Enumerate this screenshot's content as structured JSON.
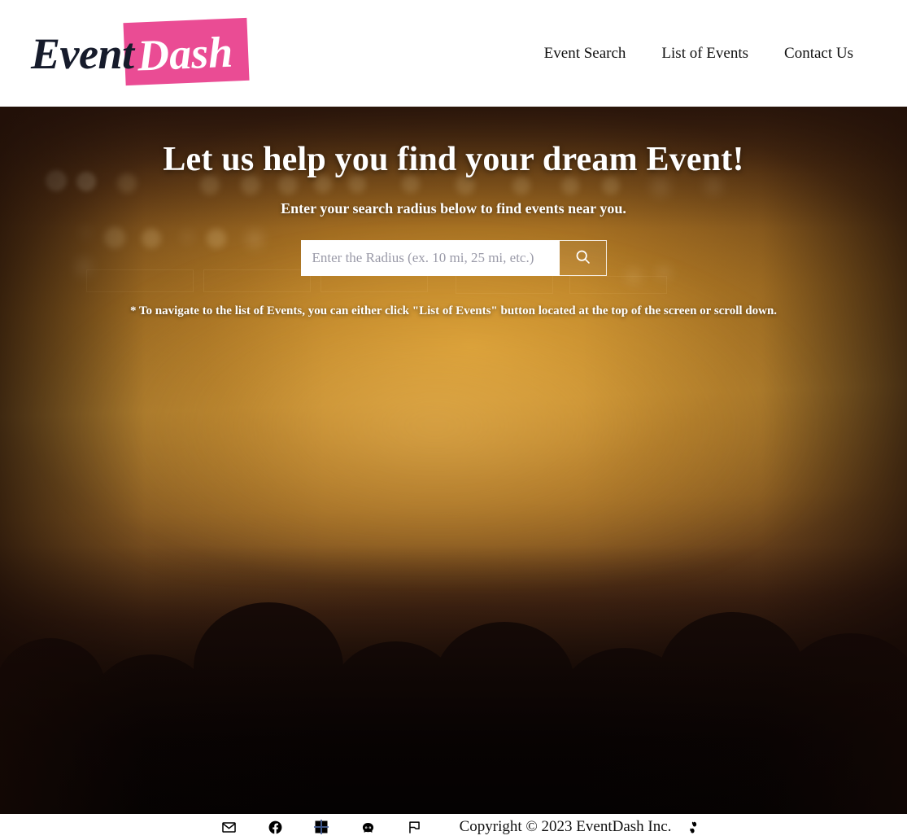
{
  "header": {
    "logo": {
      "part1": "Event",
      "part2": "Dash",
      "accent_color": "#ea4c94",
      "text_color": "#161b2b"
    },
    "nav": [
      {
        "label": "Event Search",
        "name": "nav-event-search"
      },
      {
        "label": "List of Events",
        "name": "nav-list-of-events"
      },
      {
        "label": "Contact Us",
        "name": "nav-contact-us"
      }
    ]
  },
  "hero": {
    "title": "Let us help you find your dream Event!",
    "subtitle": "Enter your search radius below to find events near you.",
    "search": {
      "value": "",
      "placeholder": "Enter the Radius (ex. 10 mi, 25 mi, etc.)",
      "button_icon": "search-icon"
    },
    "note": "* To navigate to the list of Events, you can either click \"List of Events\" button located at the top of the screen or scroll down.",
    "background": "concert crowd with raised hands, warm amber stage lighting"
  },
  "footer": {
    "social": [
      {
        "name": "email-icon",
        "label": "Email"
      },
      {
        "name": "facebook-icon",
        "label": "Facebook"
      },
      {
        "name": "microsoft-icon",
        "label": "Microsoft"
      },
      {
        "name": "github-icon",
        "label": "GitHub"
      },
      {
        "name": "flag-icon",
        "label": "Flag"
      }
    ],
    "copyright": "Copyright © 2023 EventDash Inc.",
    "brand_mark_icon": "footprints-icon"
  }
}
